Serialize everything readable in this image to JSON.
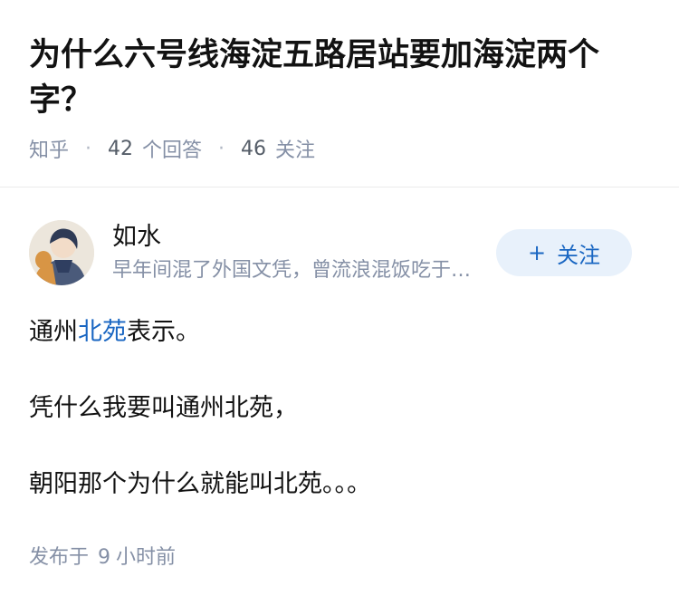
{
  "question": {
    "title": "为什么六号线海淀五路居站要加海淀两个字？",
    "source": "知乎",
    "answer_count": "42",
    "answer_label": "个回答",
    "follower_count": "46",
    "follower_label": "关注"
  },
  "author": {
    "name": "如水",
    "bio": "早年间混了外国文凭，曾流浪混饭吃于伦敦、纽约等地",
    "follow_plus": "+",
    "follow_label": "关注"
  },
  "answer": {
    "line1_pre": "通州",
    "line1_link": "北苑",
    "line1_post": "表示。",
    "line2": "凭什么我要叫通州北苑，",
    "line3": "朝阳那个为什么就能叫北苑。。。",
    "published_prefix": "发布于",
    "published_num": "9",
    "published_suffix": "小时前"
  },
  "colors": {
    "link": "#1966c2",
    "meta": "#8590a6",
    "follow_bg": "#e8f1fb"
  }
}
